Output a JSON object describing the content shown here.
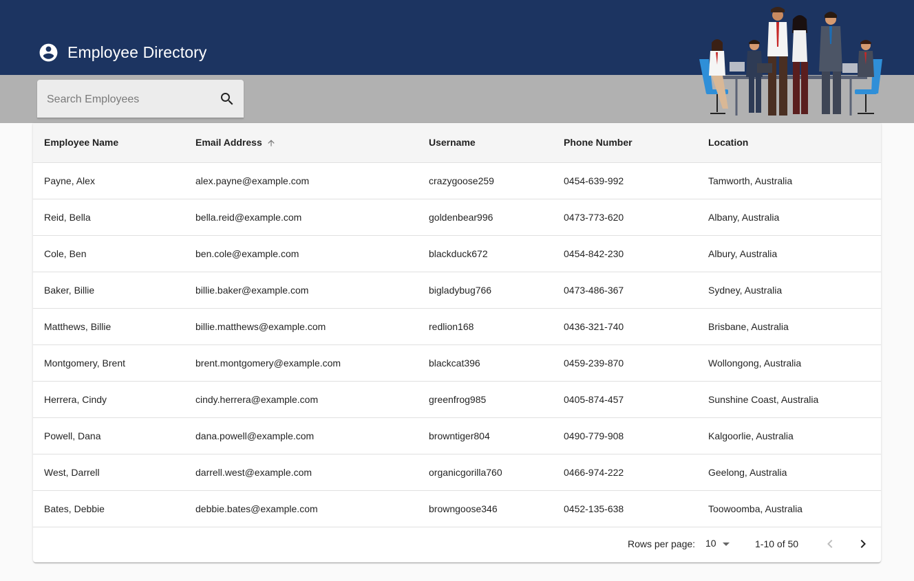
{
  "header": {
    "title": "Employee Directory",
    "background_color": "#1c3461",
    "account_icon": "account-circle-icon"
  },
  "search": {
    "placeholder": "Search Employees",
    "value": "",
    "icon": "search-icon"
  },
  "table": {
    "columns": [
      "Employee Name",
      "Email Address",
      "Username",
      "Phone Number",
      "Location"
    ],
    "sorted_column": "Email Address",
    "sort_direction": "ascending",
    "rows": [
      [
        "Payne, Alex",
        "alex.payne@example.com",
        "crazygoose259",
        "0454-639-992",
        "Tamworth, Australia"
      ],
      [
        "Reid, Bella",
        "bella.reid@example.com",
        "goldenbear996",
        "0473-773-620",
        "Albany, Australia"
      ],
      [
        "Cole, Ben",
        "ben.cole@example.com",
        "blackduck672",
        "0454-842-230",
        "Albury, Australia"
      ],
      [
        "Baker, Billie",
        "billie.baker@example.com",
        "bigladybug766",
        "0473-486-367",
        "Sydney, Australia"
      ],
      [
        "Matthews, Billie",
        "billie.matthews@example.com",
        "redlion168",
        "0436-321-740",
        "Brisbane, Australia"
      ],
      [
        "Montgomery, Brent",
        "brent.montgomery@example.com",
        "blackcat396",
        "0459-239-870",
        "Wollongong, Australia"
      ],
      [
        "Herrera, Cindy",
        "cindy.herrera@example.com",
        "greenfrog985",
        "0405-874-457",
        "Sunshine Coast, Australia"
      ],
      [
        "Powell, Dana",
        "dana.powell@example.com",
        "browntiger804",
        "0490-779-908",
        "Kalgoorlie, Australia"
      ],
      [
        "West, Darrell",
        "darrell.west@example.com",
        "organicgorilla760",
        "0466-974-222",
        "Geelong, Australia"
      ],
      [
        "Bates, Debbie",
        "debbie.bates@example.com",
        "browngoose346",
        "0452-135-638",
        "Toowoomba, Australia"
      ]
    ]
  },
  "pagination": {
    "rows_per_page_label": "Rows per page:",
    "rows_per_page_value": "10",
    "range_label": "1-10 of 50",
    "prev_icon": "chevron-left-icon",
    "next_icon": "chevron-right-icon"
  }
}
